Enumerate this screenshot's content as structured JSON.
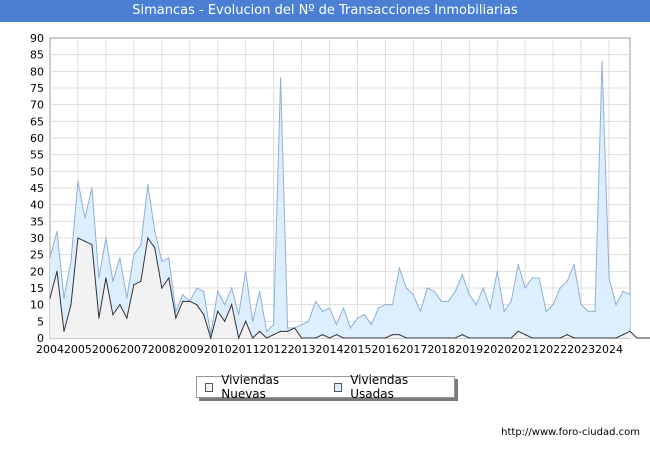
{
  "header": {
    "title": "Simancas - Evolucion del Nº de Transacciones Inmobiliarias"
  },
  "footer": {
    "source": "http://www.foro-ciudad.com"
  },
  "colors": {
    "nuevas_fill": "#f2f2f2",
    "nuevas_line": "#333333",
    "usadas_fill": "#ddeeff",
    "usadas_line": "#8fb0d8",
    "grid": "#dddddd",
    "title_bg": "#4a7fd4"
  },
  "chart_data": {
    "type": "area",
    "title": "Simancas - Evolucion del Nº de Transacciones Inmobiliarias",
    "xlabel": "",
    "ylabel": "",
    "ylim": [
      0,
      90
    ],
    "yticks": [
      0,
      5,
      10,
      15,
      20,
      25,
      30,
      35,
      40,
      45,
      50,
      55,
      60,
      65,
      70,
      75,
      80,
      85,
      90
    ],
    "xticks": [
      "2004",
      "2005",
      "2006",
      "2007",
      "2008",
      "2009",
      "2010",
      "2011",
      "2012",
      "2013",
      "2014",
      "2015",
      "2016",
      "2017",
      "2018",
      "2019",
      "2020",
      "2021",
      "2022",
      "2023",
      "2024"
    ],
    "x_start_year": 2004,
    "frequency": "quarterly",
    "grid": true,
    "legend_position": "bottom",
    "series": [
      {
        "name": "Viviendas Nuevas",
        "values": [
          12,
          20,
          2,
          10,
          30,
          29,
          28,
          6,
          18,
          7,
          10,
          6,
          16,
          17,
          30,
          27,
          15,
          18,
          6,
          11,
          11,
          10,
          7,
          0,
          8,
          5,
          10,
          0,
          5,
          0,
          2,
          0,
          1,
          2,
          2,
          3,
          0,
          0,
          0,
          1,
          0,
          1,
          0,
          0,
          0,
          0,
          0,
          0,
          0,
          1,
          1,
          0,
          0,
          0,
          0,
          0,
          0,
          0,
          0,
          1,
          0,
          0,
          0,
          0,
          0,
          0,
          0,
          2,
          1,
          0,
          0,
          0,
          0,
          0,
          1,
          0,
          0,
          0,
          0,
          0,
          0,
          0,
          1,
          2,
          0,
          0,
          0,
          1,
          0,
          1,
          0
        ]
      },
      {
        "name": "Viviendas Usadas",
        "values": [
          24,
          32,
          12,
          23,
          47,
          36,
          45,
          18,
          30,
          17,
          24,
          12,
          25,
          28,
          46,
          32,
          23,
          24,
          8,
          13,
          11,
          15,
          14,
          1,
          14,
          10,
          15,
          7,
          20,
          5,
          14,
          2,
          4,
          78,
          3,
          3,
          4,
          5,
          11,
          8,
          9,
          4,
          9,
          3,
          6,
          7,
          4,
          9,
          10,
          10,
          21,
          15,
          13,
          8,
          15,
          14,
          11,
          11,
          14,
          19,
          13,
          10,
          15,
          9,
          20,
          8,
          11,
          22,
          15,
          18,
          18,
          8,
          10,
          15,
          17,
          22,
          10,
          8,
          8,
          83,
          18,
          10,
          14,
          13
        ]
      }
    ]
  }
}
